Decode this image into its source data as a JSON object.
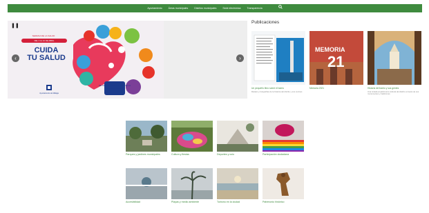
{
  "nav": {
    "items": [
      "Ayuntamiento",
      "Áreas municipales",
      "Distritos municipales",
      "Sede electrónica",
      "Transparencia"
    ],
    "search_icon": "search-icon"
  },
  "carousel": {
    "pause_label": "❚❚",
    "prev_label": "‹",
    "next_label": "›",
    "slide": {
      "subtitle": "SEMANA DE LA SALUD",
      "banner": "DEL 4 AL 10 DE ABRIL",
      "title_line1": "CUIDA",
      "title_line2": "TU SALUD",
      "date_text": "DE 10:00 A 14:00 H\nPLAZA DE LA CONSTITUCIÓN",
      "org": "Ayuntamiento de Málaga"
    }
  },
  "publications": {
    "heading": "Publicaciones",
    "cards": [
      {
        "title": "Un pequeño libro sobre el barrio",
        "desc": "Relatos y fotografías de la historia del distrito y sus vecinos"
      },
      {
        "title": "Memoria 2021",
        "desc": ""
      },
      {
        "title": "Historia del barrio y sus gentes",
        "desc": "Una mirada al patrimonio cultural del distrito a través de sus monumentos y tradiciones"
      }
    ]
  },
  "gallery": {
    "items": [
      "Parques y jardines municipales",
      "Cultura y fiestas",
      "Deportes y ocio",
      "Participación ciudadana",
      "Accesibilidad",
      "Playas y medio ambiente",
      "Turismo en la ciudad",
      "Patrimonio histórico"
    ]
  },
  "colors": {
    "brand_green": "#3f8b3f",
    "promo_red": "#d4203a",
    "promo_blue": "#1b3b8c"
  }
}
